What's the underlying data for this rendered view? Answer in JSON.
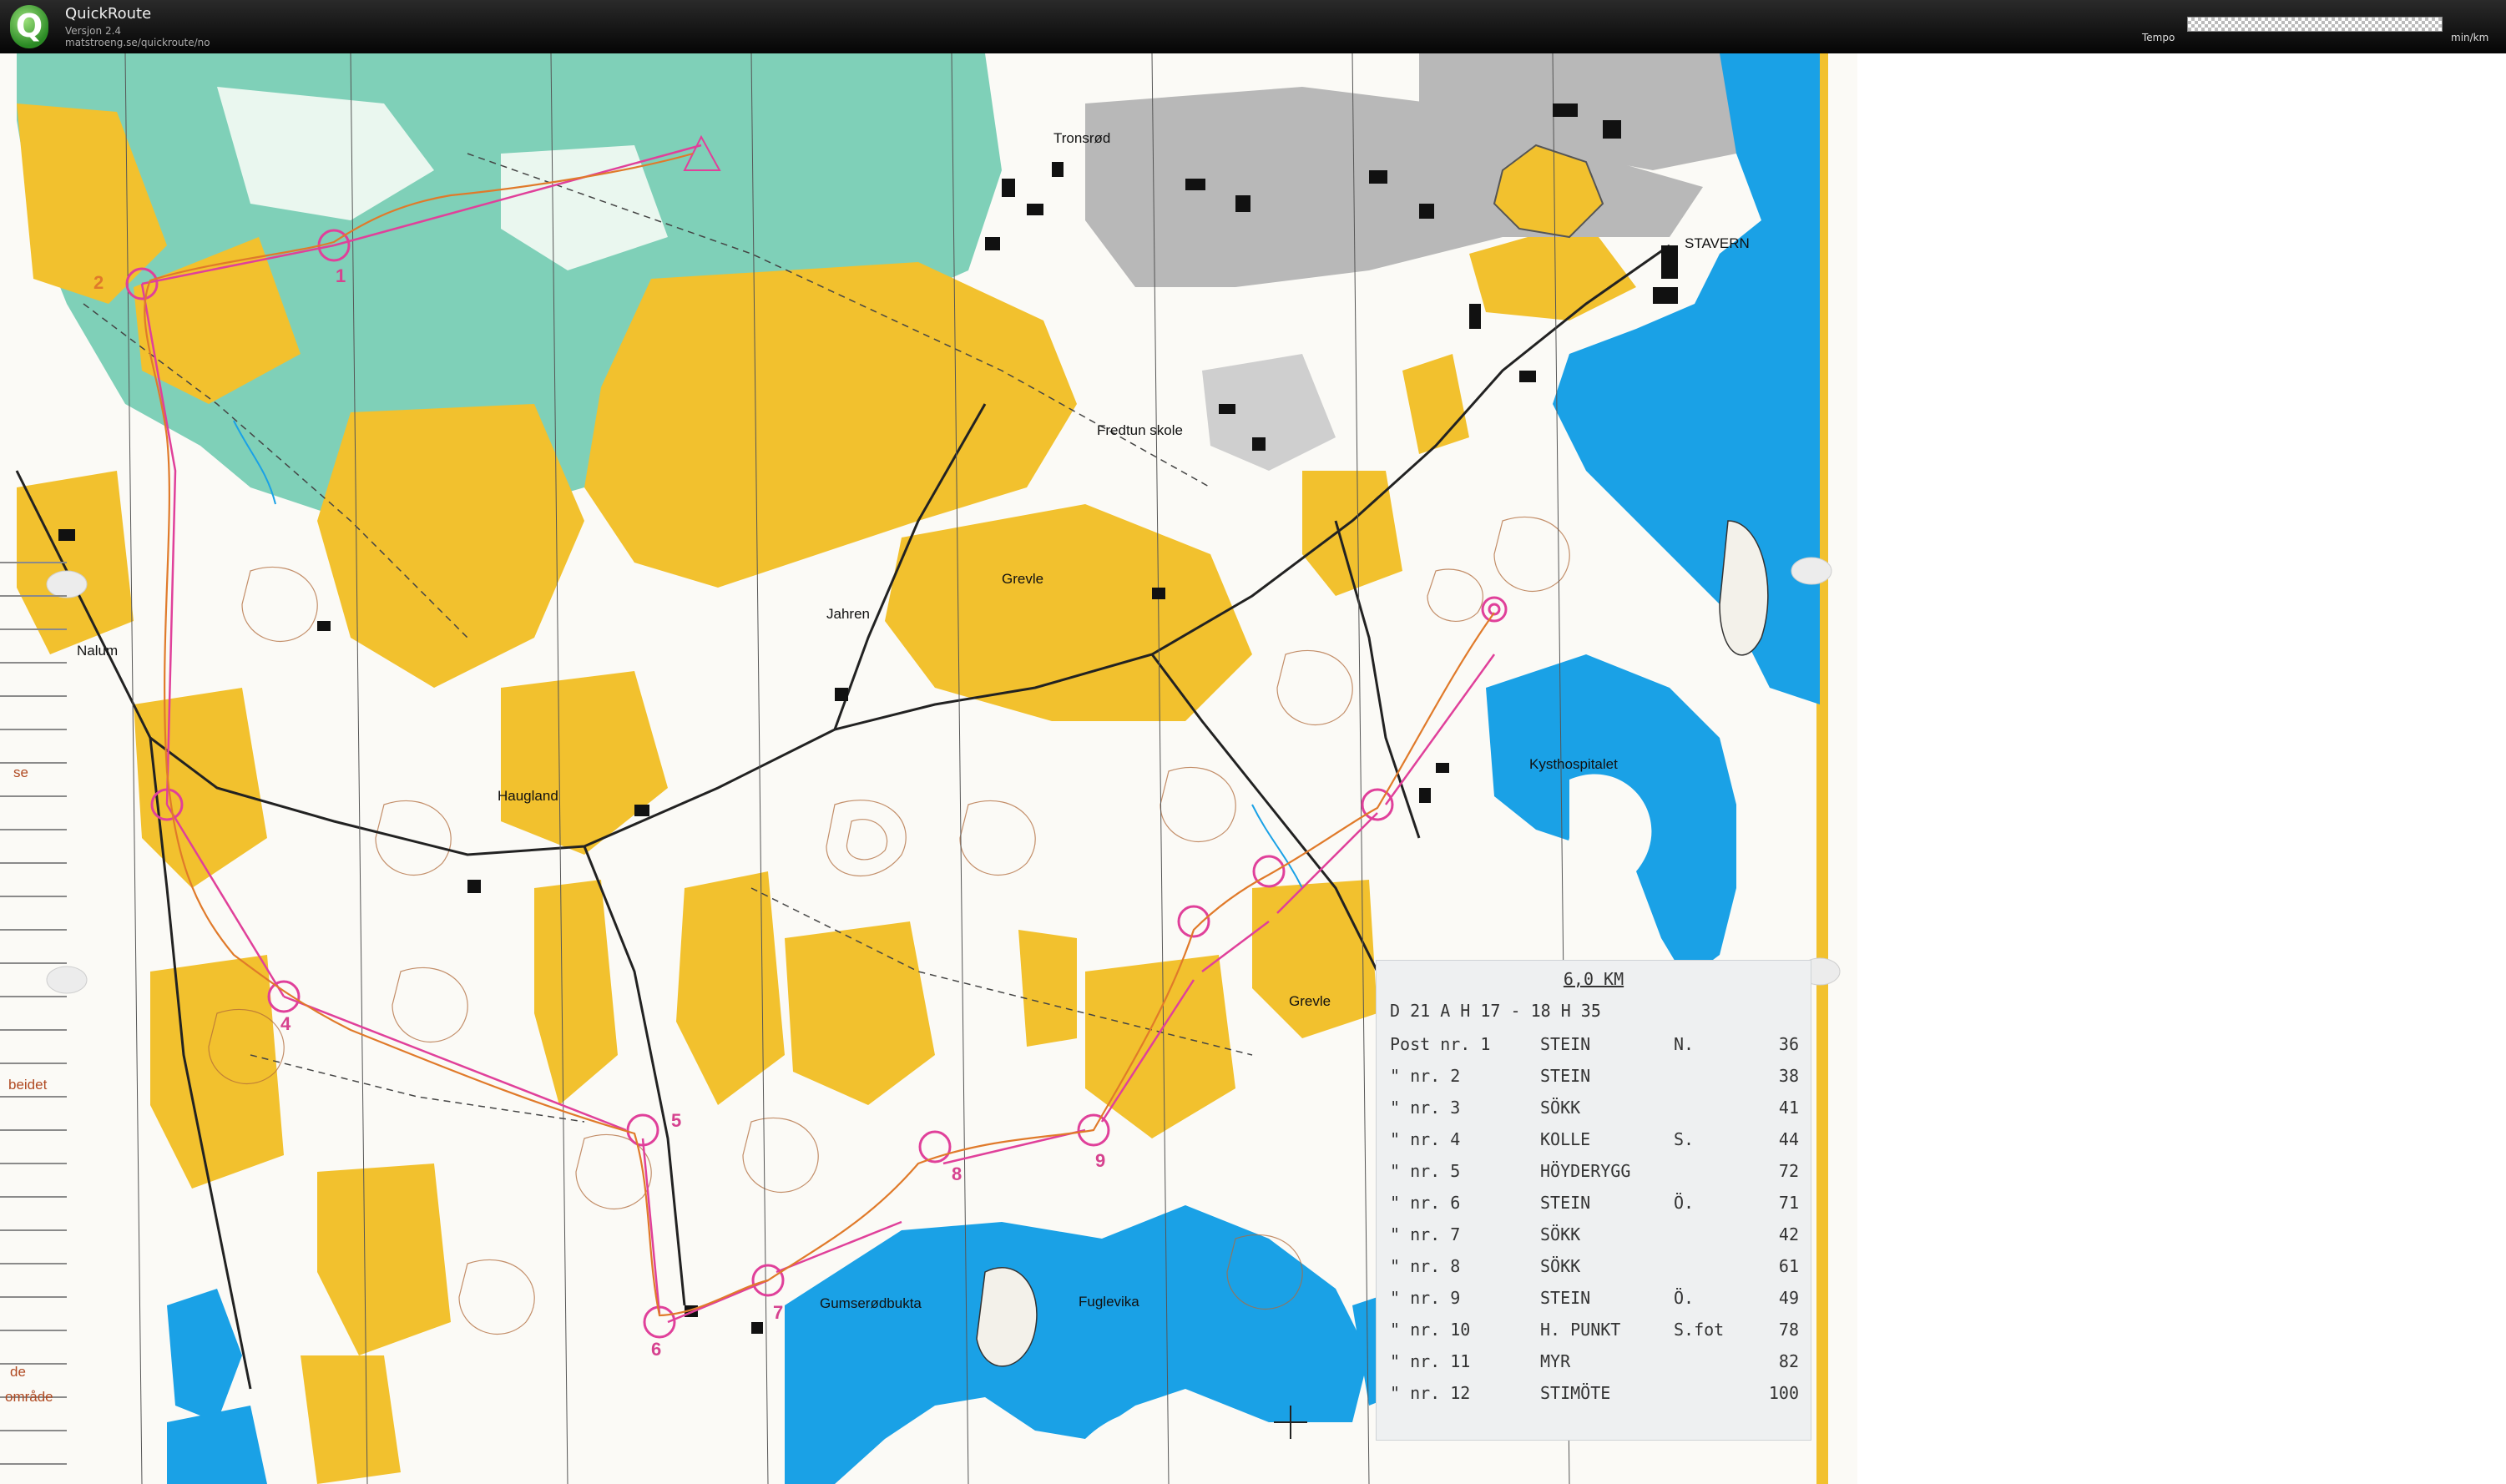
{
  "window": {
    "title": "QuickRoute",
    "version": "Versjon 2.4",
    "url": "matstroeng.se/quickroute/no"
  },
  "tempo_bar": {
    "label": "Tempo",
    "unit": "min/km"
  },
  "map": {
    "places": {
      "tronsrod": "Tronsrød",
      "stavern": "STAVERN",
      "fredtun": "Fredtun skole",
      "nalum": "Nalum",
      "jahren": "Jahren",
      "grevle1": "Grevle",
      "grevle2": "Grevle",
      "haugland": "Haugland",
      "kysthospitalet": "Kysthospitalet",
      "gumserodbukta": "Gumserødbukta",
      "fuglevika": "Fuglevika"
    },
    "edge_labels": [
      "se",
      "beidet",
      "de",
      "område"
    ],
    "controls": [
      "1",
      "2",
      "4",
      "5",
      "6",
      "7",
      "8",
      "9"
    ],
    "colors": {
      "open_land": "#f2c12e",
      "forest_green": "#7fd0b8",
      "water": "#1aa1e6",
      "urban": "#b5b5b5",
      "course": "#e0409a",
      "route": "#e07a2a"
    }
  },
  "course_card": {
    "distance": "6,0 KM",
    "class_line": "D 21 A  H 17 - 18  H 35",
    "rows": [
      {
        "prefix": "Post nr.  1",
        "desc": "STEIN",
        "side": "N.",
        "code": "36"
      },
      {
        "prefix": " \"   nr.  2",
        "desc": "STEIN",
        "side": "",
        "code": "38"
      },
      {
        "prefix": " \"   nr.  3",
        "desc": "SÖKK",
        "side": "",
        "code": "41"
      },
      {
        "prefix": " \"   nr.  4",
        "desc": "KOLLE",
        "side": "S.",
        "code": "44"
      },
      {
        "prefix": " \"   nr.  5",
        "desc": "HÖYDERYGG",
        "side": "",
        "code": "72"
      },
      {
        "prefix": " \"   nr.  6",
        "desc": "STEIN",
        "side": "Ö.",
        "code": "71"
      },
      {
        "prefix": " \"   nr.  7",
        "desc": "SÖKK",
        "side": "",
        "code": "42"
      },
      {
        "prefix": " \"   nr.  8",
        "desc": "SÖKK",
        "side": "",
        "code": "61"
      },
      {
        "prefix": " \"   nr.  9",
        "desc": "STEIN",
        "side": "Ö.",
        "code": "49"
      },
      {
        "prefix": " \"   nr. 10",
        "desc": "H. PUNKT",
        "side": "S.fot",
        "code": "78"
      },
      {
        "prefix": " \"   nr. 11",
        "desc": "MYR",
        "side": "",
        "code": "82"
      },
      {
        "prefix": " \"   nr. 12",
        "desc": "STIMÖTE",
        "side": "",
        "code": "100"
      }
    ]
  }
}
